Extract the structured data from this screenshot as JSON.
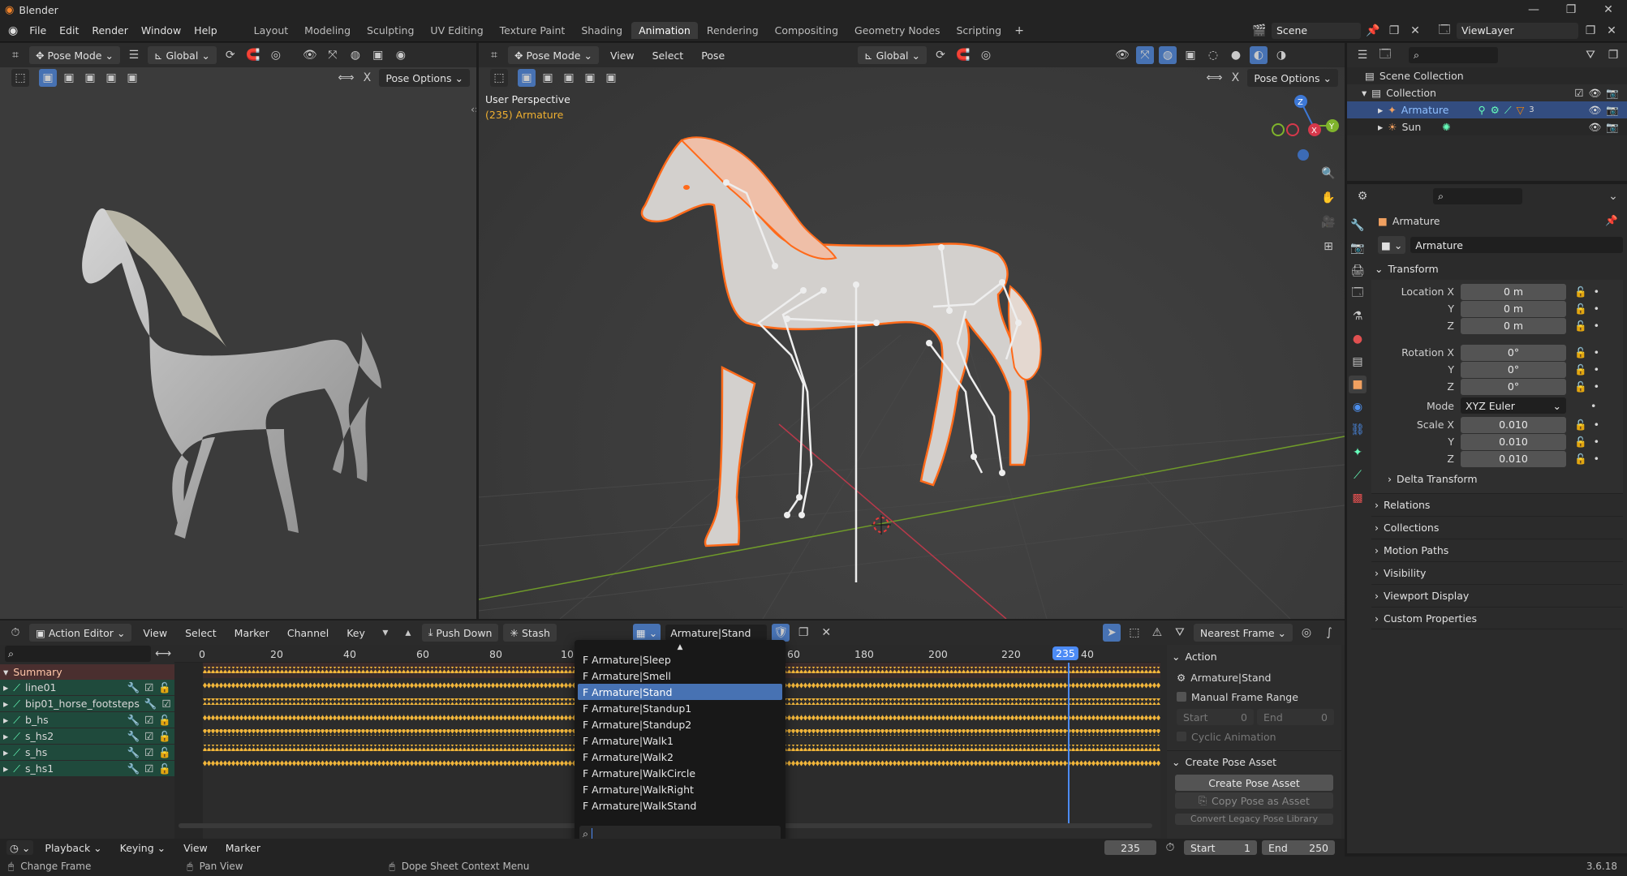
{
  "app": {
    "title": "Blender",
    "version": "3.6.18"
  },
  "menus": [
    "File",
    "Edit",
    "Render",
    "Window",
    "Help"
  ],
  "workspaces": [
    "Layout",
    "Modeling",
    "Sculpting",
    "UV Editing",
    "Texture Paint",
    "Shading",
    "Animation",
    "Rendering",
    "Compositing",
    "Geometry Nodes",
    "Scripting"
  ],
  "active_workspace": "Animation",
  "scene": "Scene",
  "view_layer": "ViewLayer",
  "left_view": {
    "mode": "Pose Mode",
    "orientation": "Global",
    "pose_options": "Pose Options"
  },
  "main_view": {
    "mode": "Pose Mode",
    "menus": [
      "View",
      "Select",
      "Pose"
    ],
    "orientation": "Global",
    "pose_options": "Pose Options",
    "overlay_title": "User Perspective",
    "overlay_sub": "(235) Armature"
  },
  "outliner": {
    "items": [
      {
        "label": "Scene Collection"
      },
      {
        "label": "Collection"
      },
      {
        "label": "Armature",
        "badge": "3"
      },
      {
        "label": "Sun"
      }
    ]
  },
  "properties": {
    "object_name": "Armature",
    "data_name": "Armature",
    "transform_label": "Transform",
    "location": {
      "label_x": "Location X",
      "label_y": "Y",
      "label_z": "Z",
      "x": "0 m",
      "y": "0 m",
      "z": "0 m"
    },
    "rotation": {
      "label_x": "Rotation X",
      "label_y": "Y",
      "label_z": "Z",
      "x": "0°",
      "y": "0°",
      "z": "0°"
    },
    "mode_label": "Mode",
    "mode": "XYZ Euler",
    "scale": {
      "label_x": "Scale X",
      "label_y": "Y",
      "label_z": "Z",
      "x": "0.010",
      "y": "0.010",
      "z": "0.010"
    },
    "sections": [
      "Delta Transform",
      "Relations",
      "Collections",
      "Motion Paths",
      "Visibility",
      "Viewport Display",
      "Custom Properties"
    ]
  },
  "action_editor": {
    "editor": "Action Editor",
    "menus": [
      "View",
      "Select",
      "Marker",
      "Channel",
      "Key"
    ],
    "push_down": "Push Down",
    "stash": "Stash",
    "action": "Armature|Stand",
    "snap": "Nearest Frame",
    "ruler": [
      "0",
      "20",
      "40",
      "60",
      "80",
      "10",
      "60",
      "180",
      "200",
      "220",
      "40"
    ],
    "current_frame": "235",
    "summary": "Summary",
    "channels": [
      "line01",
      "bip01_horse_footsteps",
      "b_hs",
      "s_hs2",
      "s_hs",
      "s_hs1"
    ],
    "dropdown": {
      "items": [
        "F Armature|Sleep",
        "F Armature|Smell",
        "F Armature|Stand",
        "F Armature|Standup1",
        "F Armature|Standup2",
        "F Armature|Walk1",
        "F Armature|Walk2",
        "F Armature|WalkCircle",
        "F Armature|WalkRight",
        "F Armature|WalkStand"
      ],
      "selected": 2
    },
    "side": {
      "action_label": "Action",
      "action_name": "Armature|Stand",
      "manual_range": "Manual Frame Range",
      "start_label": "Start",
      "start": "0",
      "end_label": "End",
      "end": "0",
      "cyclic": "Cyclic Animation",
      "pose_asset_label": "Create Pose Asset",
      "create_pose_asset": "Create Pose Asset",
      "copy_pose": "Copy Pose as Asset",
      "convert_legacy": "Convert Legacy Pose Library"
    }
  },
  "timeline": {
    "menus": [
      "Playback",
      "Keying",
      "View",
      "Marker"
    ],
    "current_frame": "235",
    "start_label": "Start",
    "start": "1",
    "end_label": "End",
    "end": "250"
  },
  "status": {
    "change_frame": "Change Frame",
    "pan_view": "Pan View",
    "context_menu": "Dope Sheet Context Menu"
  },
  "colors": {
    "accent": "#4772b3",
    "selection": "#ff7a2a",
    "playhead": "#4c8bf5",
    "x_axis": "#d6384b",
    "y_axis": "#7fb32c",
    "z_axis": "#3d78d6"
  }
}
